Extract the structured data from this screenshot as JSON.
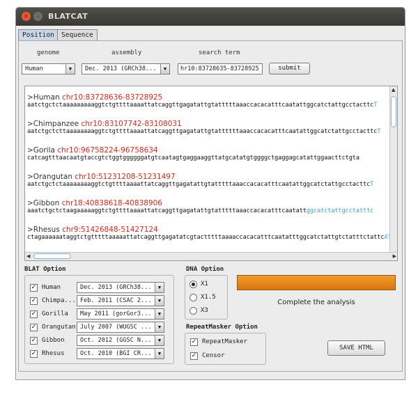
{
  "window": {
    "title": "BLATCAT"
  },
  "tabs": [
    {
      "label": "Position",
      "active": true
    },
    {
      "label": "Sequence",
      "active": false
    }
  ],
  "search": {
    "genome_label": "genome",
    "assembly_label": "assembly",
    "term_label": "search term",
    "genome_value": "Human",
    "assembly_value": "Dec. 2013 (GRCh38...",
    "term_value": "hr10:83728635-83728925",
    "submit_label": "submit"
  },
  "sequences": [
    {
      "species": ">Human",
      "coords": "chr10:83728636-83728925",
      "seq": "aatctgctctaaaaaaaaaggtctgttttaaaattatcaggttgagatattgtatttttaaaccacacatttcaatattggcatctattgcctacttc",
      "tail": "T"
    },
    {
      "species": ">Chimpanzee",
      "coords": "chr10:83107742-83108031",
      "seq": "aatctgctcttaaaaaaaaggtctgttttaaaattatcaggttgagatattgtattttttaaaccacacatttcaatattggcatctattgcctacttc",
      "tail": "T"
    },
    {
      "species": ">Gorila",
      "coords": "chr10:96758224-96758634",
      "seq": "catcagtttaacaatgtaccgtctggtggggggatgtcaatagtgaggaaggttatgcatatgtggggctgaggagcatattggaacttctgta",
      "tail": ""
    },
    {
      "species": ">Orangutan",
      "coords": "chr10:51231208-51231497",
      "seq": "aatctgctctaaaaaaaaggtctgttttaaaattatcaggttgagatattgtatttttaaaccacacatttcaatattggcatctattgcctacttc",
      "tail": "T"
    },
    {
      "species": ">Gibbon",
      "coords": "chr18:40838618-40838906",
      "seq": "aaatctgctctaagaaaaaggtctgttttaaaattatcaggttgagatattgtatttttaaaccacacatttcaatatt",
      "tail": "ggcatctattgcctatttc"
    },
    {
      "species": ">Rhesus",
      "coords": "chr9:51426848-51427124",
      "seq": "ctagaaaaaataggtctgtttttaaaaattatcaggttgagatatcgtactttttaaaaccacacatttcaatatttggcatctattgtctatttctattc",
      "tail": "AT"
    }
  ],
  "blat_option": {
    "title": "BLAT Option",
    "rows": [
      {
        "species": "Human",
        "checked": true,
        "assembly": "Dec. 2013 (GRCh38..."
      },
      {
        "species": "Chimpa...",
        "checked": true,
        "assembly": "Feb. 2011 (CSAC 2..."
      },
      {
        "species": "Gorilla",
        "checked": true,
        "assembly": "May 2011 (gorGor3..."
      },
      {
        "species": "Orangutan",
        "checked": true,
        "assembly": "July 2007 (WUGSC ..."
      },
      {
        "species": "Gibbon",
        "checked": true,
        "assembly": "Oct. 2012 (GGSC N..."
      },
      {
        "species": "Rhesus",
        "checked": true,
        "assembly": "Oct. 2010 (BGI CR..."
      }
    ]
  },
  "dna_option": {
    "title": "DNA Option",
    "options": [
      {
        "label": "X1",
        "selected": true
      },
      {
        "label": "X1.5",
        "selected": false
      },
      {
        "label": "X3",
        "selected": false
      }
    ]
  },
  "progress": {
    "fraction": 1.0,
    "status": "Complete the analysis",
    "color": "#e8860f"
  },
  "repeatmasker": {
    "title": "RepeatMasker Option",
    "options": [
      {
        "label": "RepeatMasker",
        "checked": true
      },
      {
        "label": "Censor",
        "checked": true
      }
    ]
  },
  "save_html_label": "SAVE HTML",
  "icons": {
    "close": "close-icon",
    "minimize": "minimize-icon",
    "dropdown": "chevron-down-icon"
  }
}
